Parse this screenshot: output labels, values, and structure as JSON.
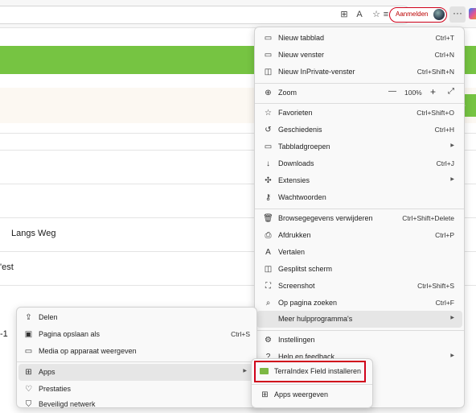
{
  "page": {
    "rows": [
      "Langs Weg",
      "'est",
      "-1"
    ]
  },
  "toolbar": {
    "sign_in_label": "Aanmelden",
    "more_label": "···"
  },
  "main_menu": {
    "items": [
      {
        "label": "Nieuw tabblad",
        "shortcut": "Ctrl+T",
        "icon": "new-tab-icon"
      },
      {
        "label": "Nieuw venster",
        "shortcut": "Ctrl+N",
        "icon": "new-window-icon"
      },
      {
        "label": "Nieuw InPrivate-venster",
        "shortcut": "Ctrl+Shift+N",
        "icon": "inprivate-icon"
      },
      {
        "label": "Zoom",
        "zoom_minus": "—",
        "zoom_value": "100%",
        "zoom_plus": "+",
        "icon": "zoom-icon"
      },
      {
        "label": "Favorieten",
        "shortcut": "Ctrl+Shift+O",
        "icon": "favorites-icon"
      },
      {
        "label": "Geschiedenis",
        "shortcut": "Ctrl+H",
        "icon": "history-icon"
      },
      {
        "label": "Tabbladgroepen",
        "shortcut": "",
        "icon": "tab-groups-icon"
      },
      {
        "label": "Downloads",
        "shortcut": "Ctrl+J",
        "icon": "download-icon"
      },
      {
        "label": "Extensies",
        "shortcut": "",
        "icon": "extensions-icon"
      },
      {
        "label": "Wachtwoorden",
        "shortcut": "",
        "icon": "key-icon"
      },
      {
        "label": "Browsegegevens verwijderen",
        "shortcut": "Ctrl+Shift+Delete",
        "icon": "trash-icon"
      },
      {
        "label": "Afdrukken",
        "shortcut": "Ctrl+P",
        "icon": "print-icon"
      },
      {
        "label": "Vertalen",
        "shortcut": "",
        "icon": "translate-icon"
      },
      {
        "label": "Gesplitst scherm",
        "shortcut": "",
        "icon": "split-screen-icon"
      },
      {
        "label": "Screenshot",
        "shortcut": "Ctrl+Shift+S",
        "icon": "screenshot-icon"
      },
      {
        "label": "Op pagina zoeken",
        "shortcut": "Ctrl+F",
        "icon": "find-icon"
      },
      {
        "label": "Meer hulpprogramma's",
        "shortcut": "",
        "icon": ""
      },
      {
        "label": "Instellingen",
        "shortcut": "",
        "icon": "gear-icon"
      },
      {
        "label": "Help en feedback",
        "shortcut": "",
        "icon": "help-icon"
      }
    ]
  },
  "tools_menu": {
    "items": [
      {
        "label": "Delen",
        "shortcut": "",
        "icon": "share-icon"
      },
      {
        "label": "Pagina opslaan als",
        "shortcut": "Ctrl+S",
        "icon": "save-page-icon"
      },
      {
        "label": "Media op apparaat weergeven",
        "shortcut": "",
        "icon": "cast-icon"
      },
      {
        "label": "Apps",
        "shortcut": "",
        "icon": "apps-icon"
      },
      {
        "label": "Prestaties",
        "shortcut": "",
        "icon": "performance-icon"
      },
      {
        "label": "Beveiligd netwerk",
        "shortcut": "",
        "icon": "shield-icon"
      }
    ]
  },
  "apps_menu": {
    "items": [
      {
        "label": "TerraIndex Field installeren",
        "icon": "app-folder-icon"
      },
      {
        "label": "Apps weergeven",
        "icon": "apps-icon"
      }
    ]
  },
  "colors": {
    "accent_green": "#76c442",
    "highlight_red": "#d0021b",
    "menu_bg": "#f9f9f9"
  }
}
